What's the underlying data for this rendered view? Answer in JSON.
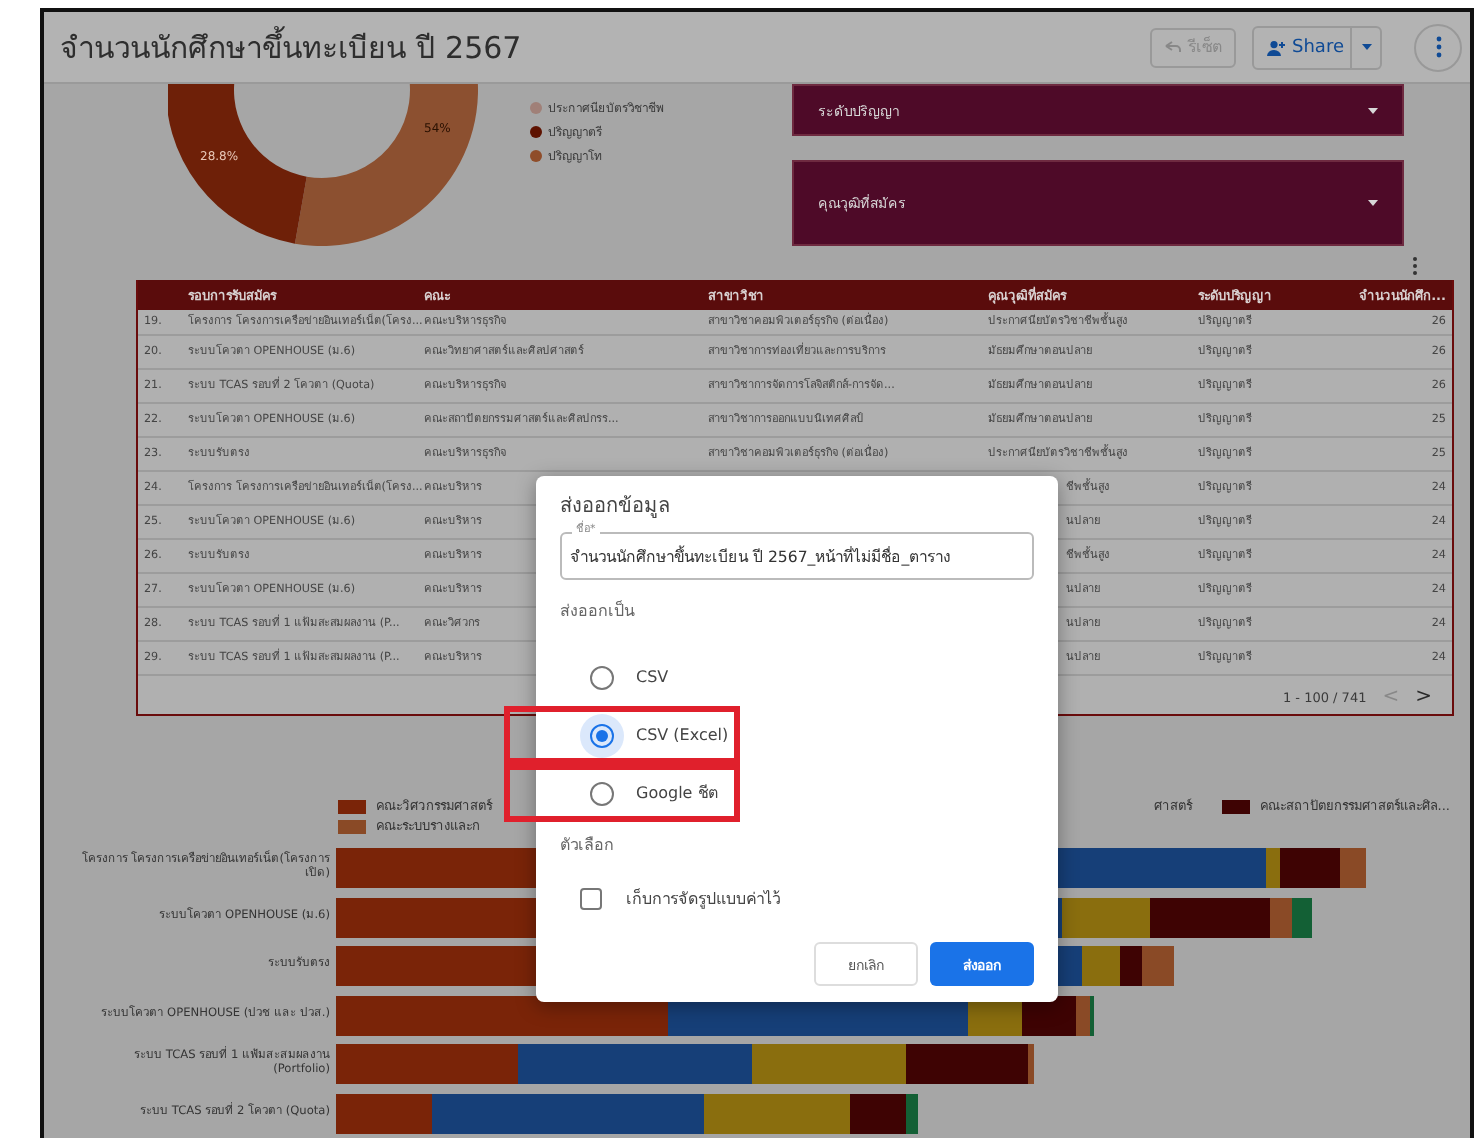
{
  "header": {
    "title": "จำนวนนักศึกษาขึ้นทะเบียน ปี 2567",
    "reset_button": {
      "label": "รีเซ็ต",
      "disabled": true
    },
    "share_button": "Share"
  },
  "donut": {
    "labels": [
      "54%",
      "28.8%"
    ],
    "legend": [
      {
        "label": "ประกาศนียบัตรวิชาชีพ",
        "color": "#a08078"
      },
      {
        "label": "ปริญญาตรี",
        "color": "#5e1200"
      },
      {
        "label": "ปริญญาโท",
        "color": "#8f4d2a"
      }
    ]
  },
  "filters": [
    {
      "label": "ระดับปริญญา"
    },
    {
      "label": "คุณวุฒิที่สมัคร"
    }
  ],
  "table": {
    "columns": [
      "",
      "รอบการรับสมัคร",
      "คณะ",
      "สาขาวิชา",
      "คุณวุฒิที่สมัคร",
      "ระดับปริญญา",
      "จำนวนนักศึก..."
    ],
    "rows": [
      {
        "num": "19.",
        "round": "โครงการ โครงการเครือข่ายอินเทอร์เน็ต(โครง...",
        "faculty": "คณะบริหารธุรกิจ",
        "branch": "สาขาวิชาคอมพิวเตอร์ธุรกิจ (ต่อเนื่อง)",
        "qualification": "ประกาศนียบัตรวิชาชีพชั้นสูง",
        "degree": "ปริญญาตรี",
        "count": "26"
      },
      {
        "num": "20.",
        "round": "ระบบโควตา OPENHOUSE (ม.6)",
        "faculty": "คณะวิทยาศาสตร์และศิลปศาสตร์",
        "branch": "สาขาวิชาการท่องเที่ยวและการบริการ",
        "qualification": "มัธยมศึกษาตอนปลาย",
        "degree": "ปริญญาตรี",
        "count": "26"
      },
      {
        "num": "21.",
        "round": "ระบบ TCAS รอบที่ 2 โควตา (Quota)",
        "faculty": "คณะบริหารธุรกิจ",
        "branch": "สาขาวิชาการจัดการโลจิสติกส์-การจัด...",
        "qualification": "มัธยมศึกษาตอนปลาย",
        "degree": "ปริญญาตรี",
        "count": "26"
      },
      {
        "num": "22.",
        "round": "ระบบโควตา OPENHOUSE (ม.6)",
        "faculty": "คณะสถาปัตยกรรมศาสตร์และศิลปกรร...",
        "branch": "สาขาวิชาการออกแบบนิเทศศิลป์",
        "qualification": "มัธยมศึกษาตอนปลาย",
        "degree": "ปริญญาตรี",
        "count": "25"
      },
      {
        "num": "23.",
        "round": "ระบบรับตรง",
        "faculty": "คณะบริหารธุรกิจ",
        "branch": "สาขาวิชาคอมพิวเตอร์ธุรกิจ (ต่อเนื่อง)",
        "qualification": "ประกาศนียบัตรวิชาชีพชั้นสูง",
        "degree": "ปริญญาตรี",
        "count": "25"
      },
      {
        "num": "24.",
        "round": "โครงการ โครงการเครือข่ายอินเทอร์เน็ต(โครง...",
        "faculty": "คณะบริหาร",
        "qualification": "ชีพชั้นสูง",
        "degree": "ปริญญาตรี",
        "count": "24"
      },
      {
        "num": "25.",
        "round": "ระบบโควตา OPENHOUSE (ม.6)",
        "faculty": "คณะบริหาร",
        "qualification": "นปลาย",
        "degree": "ปริญญาตรี",
        "count": "24"
      },
      {
        "num": "26.",
        "round": "ระบบรับตรง",
        "faculty": "คณะบริหาร",
        "qualification": "ชีพชั้นสูง",
        "degree": "ปริญญาตรี",
        "count": "24"
      },
      {
        "num": "27.",
        "round": "ระบบโควตา OPENHOUSE (ม.6)",
        "faculty": "คณะบริหาร",
        "qualification": "นปลาย",
        "degree": "ปริญญาตรี",
        "count": "24"
      },
      {
        "num": "28.",
        "round": "ระบบ TCAS รอบที่ 1 แฟ้มสะสมผลงาน (P...",
        "faculty": "คณะวิศวกร",
        "qualification": "นปลาย",
        "degree": "ปริญญาตรี",
        "count": "24"
      },
      {
        "num": "29.",
        "round": "ระบบ TCAS รอบที่ 1 แฟ้มสะสมผลงาน (P...",
        "faculty": "คณะบริหาร",
        "qualification": "นปลาย",
        "degree": "ปริญญาตรี",
        "count": "24"
      }
    ],
    "pagination": {
      "range": "1 - 100 / 741",
      "prev": "<",
      "next": ">",
      "prev_disabled": true
    }
  },
  "bar_chart": {
    "legend_rows": [
      [
        {
          "label": "คณะวิศวกรรมศาสตร์",
          "color": "#7a2408"
        },
        {
          "label": "ศาสตร์"
        },
        {
          "label": "คณะสถาปัตยกรรมศาสตร์และศิล...",
          "color": "#3e0303"
        }
      ],
      [
        {
          "label": "คณะระบบรางและก",
          "color": "#8a4a26"
        }
      ]
    ],
    "categories": [
      "โครงการ โครงการเครือข่ายอินเทอร์เน็ต(โครงการเปิด)",
      "ระบบโควตา OPENHOUSE (ม.6)",
      "ระบบรับตรง",
      "ระบบโควตา OPENHOUSE (ปวช และ ปวส.)",
      "ระบบ TCAS รอบที่ 1 แฟ้มสะสมผลงาน (Portfolio)",
      "ระบบ TCAS รอบที่ 2 โควตา (Quota)"
    ]
  },
  "dialog": {
    "title": "ส่งออกข้อมูล",
    "name_label": "ชื่อ*",
    "name_value": "จำนวนนักศึกษาขึ้นทะเบียน ปี 2567_หน้าที่ไม่มีชื่อ_ตาราง",
    "format_label": "ส่งออกเป็น",
    "formats": [
      {
        "label": "CSV",
        "selected": false,
        "highlighted": false
      },
      {
        "label": "CSV (Excel)",
        "selected": true,
        "highlighted": true
      },
      {
        "label": "Google ชีต",
        "selected": false,
        "highlighted": true
      }
    ],
    "options_label": "ตัวเลือก",
    "options": [
      {
        "label": "เก็บการจัดรูปแบบค่าไว้",
        "checked": false
      }
    ],
    "cancel": "ยกเลิก",
    "export": "ส่งออก"
  }
}
